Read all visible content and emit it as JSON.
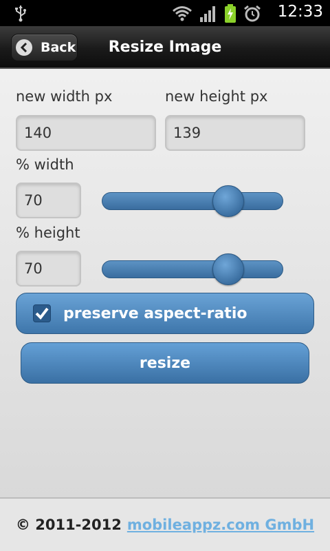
{
  "statusbar": {
    "time": "12:33",
    "icons": [
      "usb-icon",
      "wifi-icon",
      "signal-icon",
      "battery-charging-icon",
      "alarm-clock-icon"
    ]
  },
  "header": {
    "back_label": "Back",
    "title": "Resize Image"
  },
  "form": {
    "width_label": "new width px",
    "height_label": "new height px",
    "width_value": "140",
    "height_value": "139",
    "pct_width_label": "% width",
    "pct_width_value": "70",
    "pct_height_label": "% height",
    "pct_height_value": "70",
    "pct_width_slider": 0.7,
    "pct_height_slider": 0.7,
    "preserve_label": "preserve aspect-ratio",
    "preserve_checked": true,
    "resize_label": "resize"
  },
  "footer": {
    "copyright": "© 2011-2012",
    "link": "mobileappz.com GmbH"
  },
  "colors": {
    "accent": "#4a84bb",
    "link": "#6fb0e0"
  }
}
